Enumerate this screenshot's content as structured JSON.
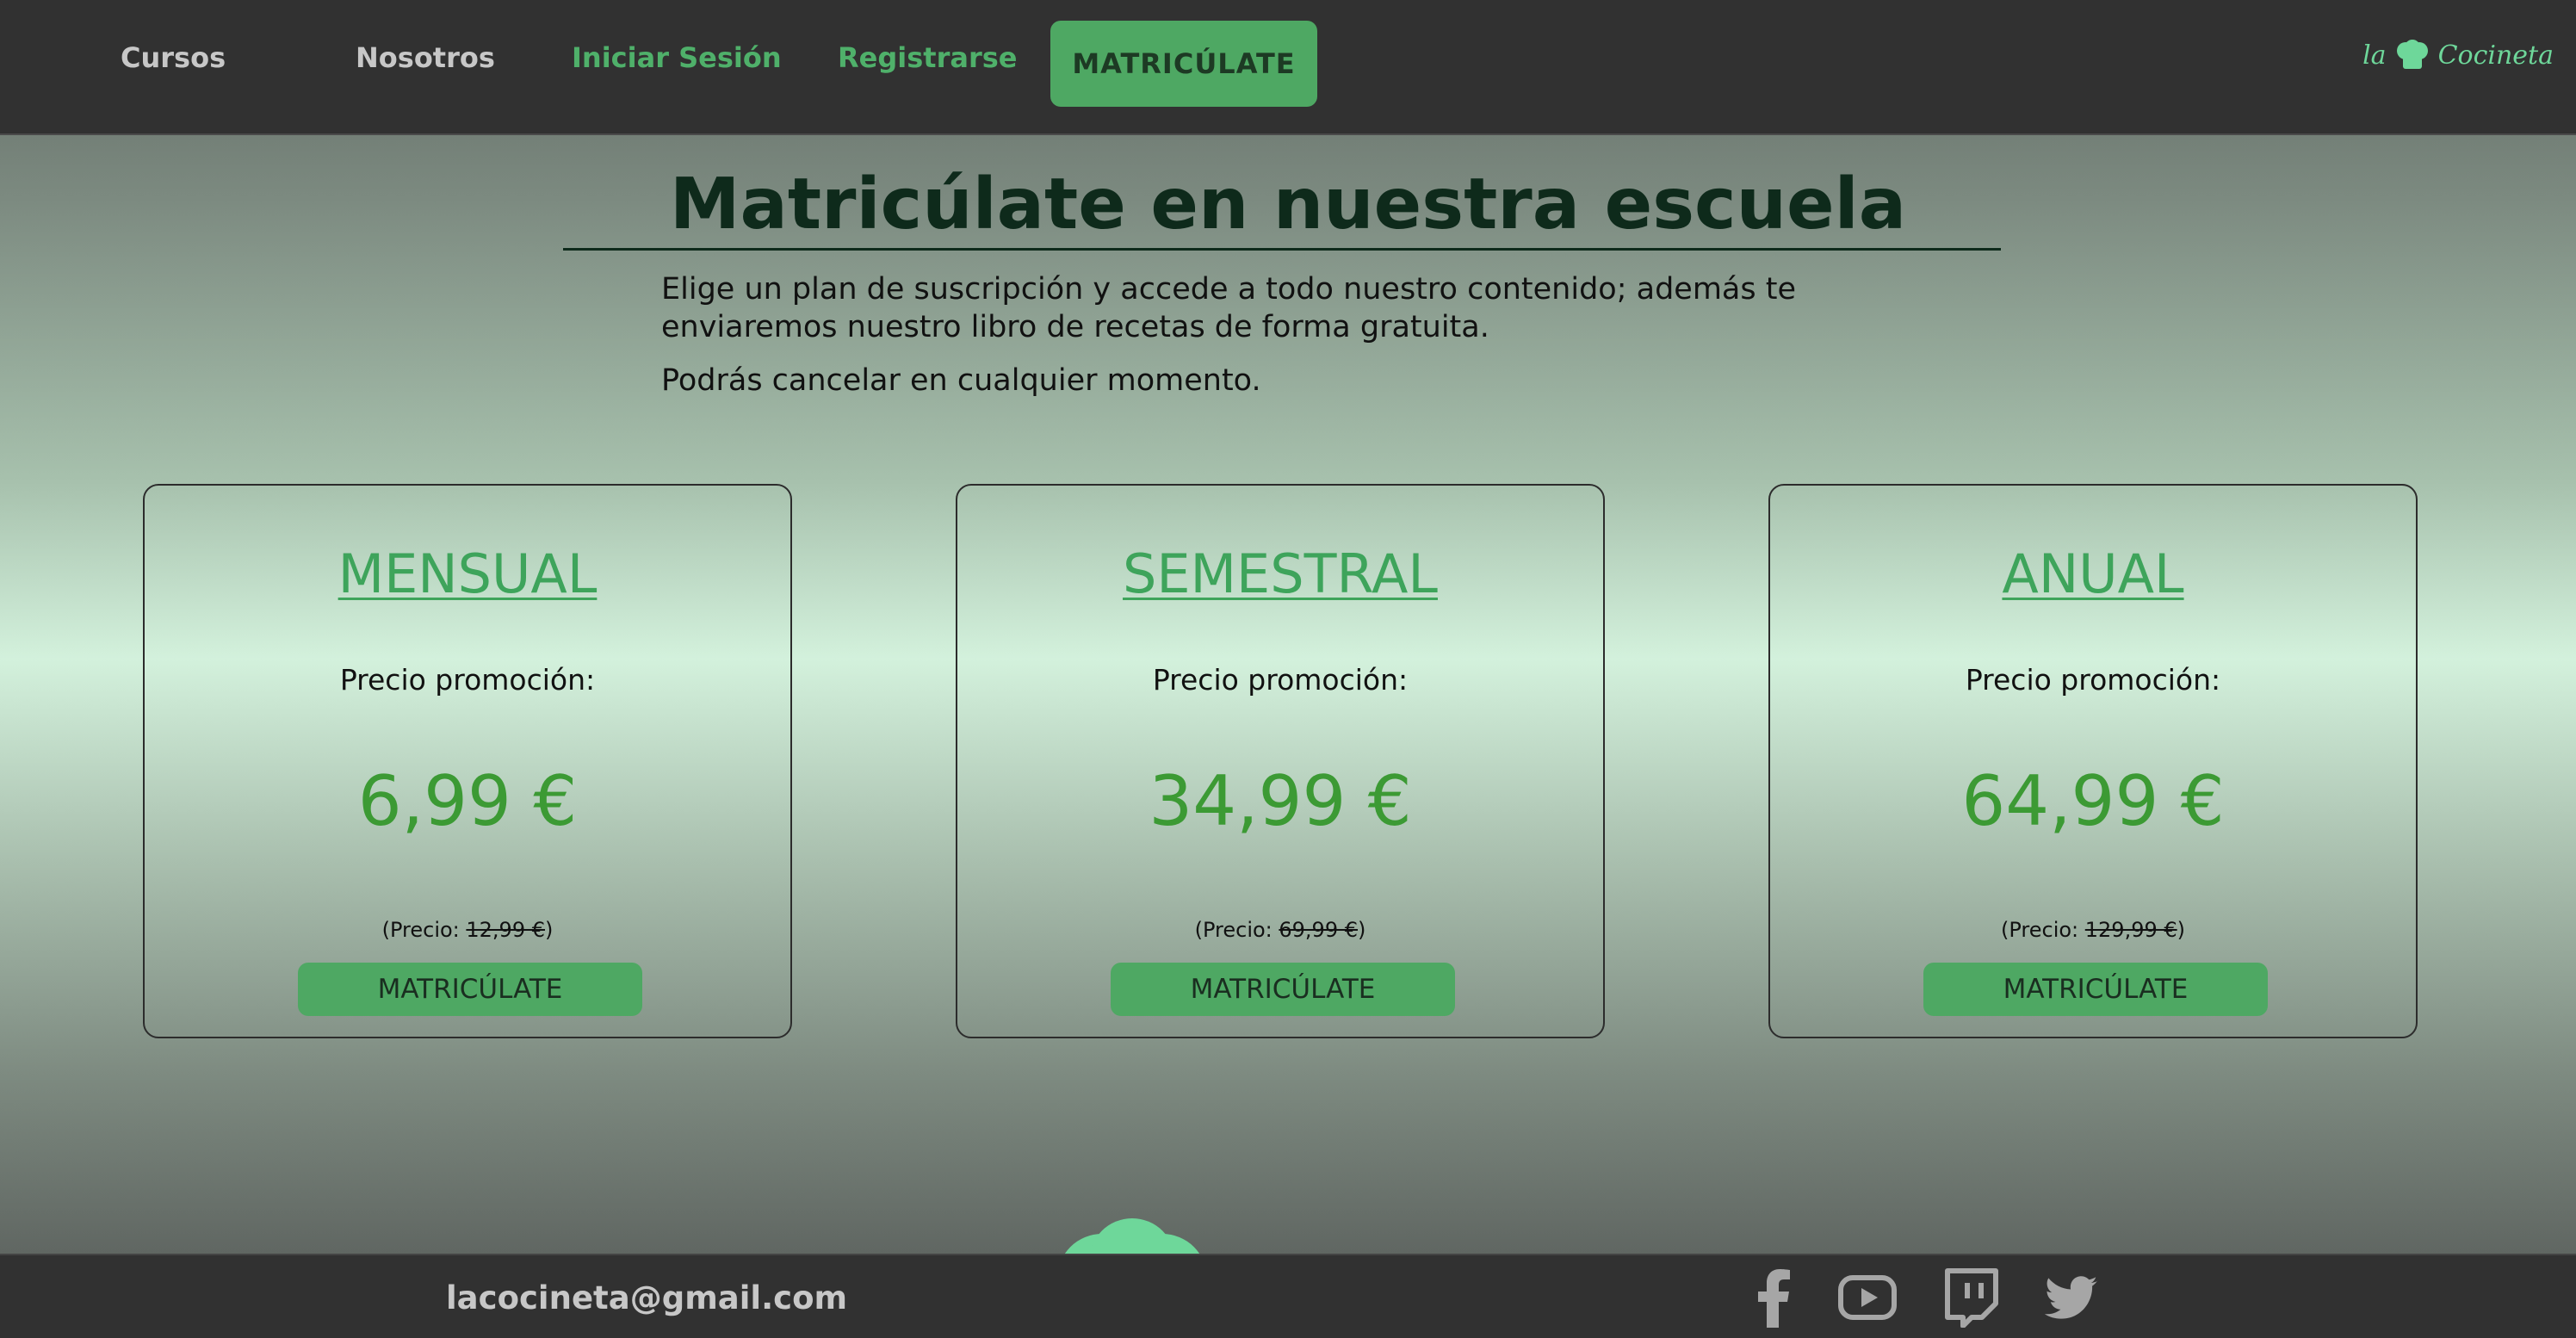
{
  "nav": {
    "links": [
      "Cursos",
      "Nosotros",
      "Iniciar Sesión",
      "Registrarse"
    ],
    "cta": "MATRICÚLATE",
    "brand": {
      "pre": "la",
      "post": "Cocineta"
    }
  },
  "hero": {
    "title": "Matricúlate en nuestra escuela",
    "paragraph1": "Elige un plan de suscripción y accede a todo nuestro contenido; además te enviaremos nuestro libro de recetas de forma gratuita.",
    "paragraph2": "Podrás cancelar en cualquier momento."
  },
  "plans": [
    {
      "name": "MENSUAL",
      "promo_label": "Precio promoción:",
      "price": "6,99 €",
      "old_prefix": "(Precio: ",
      "old_price": "12,99 €",
      "old_suffix": ")",
      "button": "MATRICÚLATE"
    },
    {
      "name": "SEMESTRAL",
      "promo_label": "Precio promoción:",
      "price": "34,99 €",
      "old_prefix": "(Precio: ",
      "old_price": "69,99 €",
      "old_suffix": ")",
      "button": "MATRICÚLATE"
    },
    {
      "name": "ANUAL",
      "promo_label": "Precio promoción:",
      "price": "64,99 €",
      "old_prefix": "(Precio: ",
      "old_price": "129,99 €",
      "old_suffix": ")",
      "button": "MATRICÚLATE"
    }
  ],
  "footer": {
    "email": "lacocineta@gmail.com",
    "social_icons": [
      "facebook-icon",
      "youtube-icon",
      "twitch-icon",
      "twitter-icon"
    ]
  },
  "colors": {
    "accent": "#4ea863",
    "nav_bg": "#313131",
    "price_green": "#3c9a34",
    "title_dark": "#0e2a1b"
  }
}
